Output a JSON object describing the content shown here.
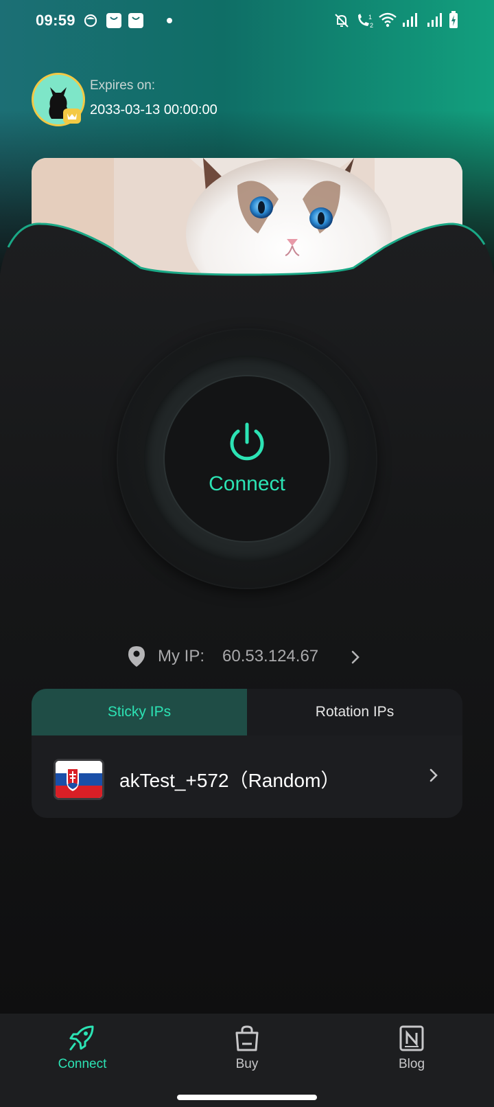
{
  "status_bar": {
    "time": "09:59"
  },
  "profile": {
    "expires_label": "Expires on:",
    "expires_value": "2033-03-13 00:00:00"
  },
  "connect": {
    "label": "Connect"
  },
  "ip": {
    "label": "My IP:",
    "value": "60.53.124.67"
  },
  "tabs": [
    {
      "label": "Sticky IPs",
      "active": true
    },
    {
      "label": "Rotation IPs",
      "active": false
    }
  ],
  "location": {
    "name": "akTest_+572（Random）",
    "flag": "slovakia-flag-icon"
  },
  "nav": [
    {
      "label": "Connect",
      "icon": "rocket-icon",
      "active": true
    },
    {
      "label": "Buy",
      "icon": "shopping-bag-icon",
      "active": false
    },
    {
      "label": "Blog",
      "icon": "notion-icon",
      "active": false
    }
  ],
  "colors": {
    "accent": "#2ce3b4",
    "gold": "#f3c944",
    "tab_active_bg": "#1f4d46",
    "background": "#0f0f10"
  }
}
